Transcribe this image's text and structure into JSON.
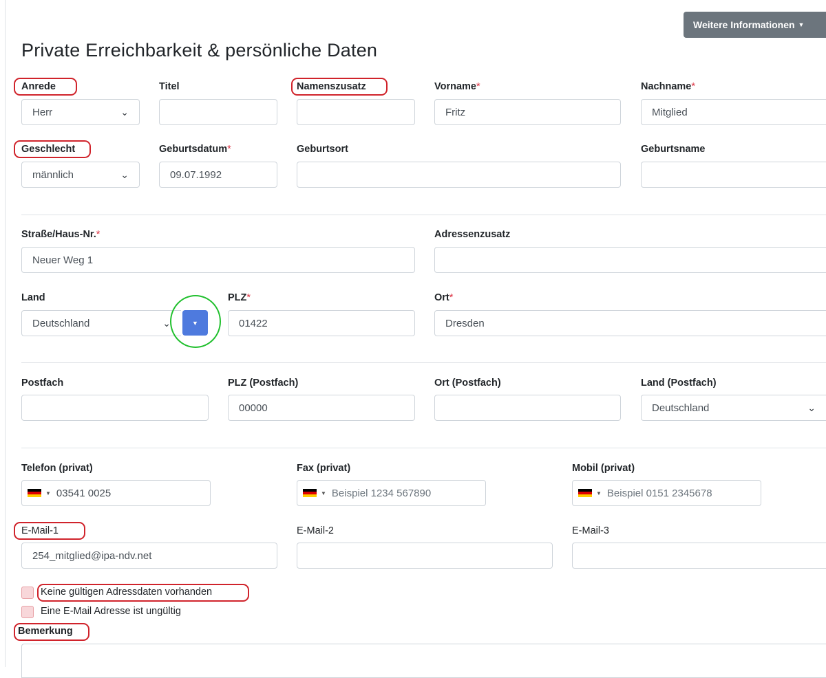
{
  "header": {
    "info_button_label": "Weitere Informationen",
    "title": "Private Erreichbarkeit & persönliche Daten"
  },
  "personal": {
    "anrede": {
      "label": "Anrede",
      "value": "Herr"
    },
    "titel": {
      "label": "Titel",
      "value": ""
    },
    "namenszusatz": {
      "label": "Namenszusatz",
      "value": ""
    },
    "vorname": {
      "label": "Vorname",
      "value": "Fritz"
    },
    "nachname": {
      "label": "Nachname",
      "value": "Mitglied"
    },
    "geschlecht": {
      "label": "Geschlecht",
      "value": "männlich"
    },
    "geburtsdatum": {
      "label": "Geburtsdatum",
      "value": "09.07.1992"
    },
    "geburtsort": {
      "label": "Geburtsort",
      "value": ""
    },
    "geburtsname": {
      "label": "Geburtsname",
      "value": ""
    },
    "required_mark": "*"
  },
  "address": {
    "strasse": {
      "label": "Straße/Haus-Nr.",
      "value": "Neuer Weg 1"
    },
    "adresszusatz": {
      "label": "Adressenzusatz",
      "value": ""
    },
    "land": {
      "label": "Land",
      "value": "Deutschland"
    },
    "plz": {
      "label": "PLZ",
      "value": "01422"
    },
    "ort": {
      "label": "Ort",
      "value": "Dresden"
    }
  },
  "postfach": {
    "postfach": {
      "label": "Postfach",
      "value": ""
    },
    "plz": {
      "label": "PLZ (Postfach)",
      "value": "00000"
    },
    "ort": {
      "label": "Ort (Postfach)",
      "value": ""
    },
    "land": {
      "label": "Land (Postfach)",
      "value": "Deutschland"
    }
  },
  "contact": {
    "telefon": {
      "label": "Telefon (privat)",
      "value": "03541 0025"
    },
    "fax": {
      "label": "Fax (privat)",
      "placeholder": "Beispiel 1234 567890"
    },
    "mobil": {
      "label": "Mobil (privat)",
      "placeholder": "Beispiel 0151 2345678"
    },
    "email1": {
      "label": "E-Mail-1",
      "value": "254_mitglied@ipa-ndv.net"
    },
    "email2": {
      "label": "E-Mail-2",
      "value": ""
    },
    "email3": {
      "label": "E-Mail-3",
      "value": ""
    }
  },
  "flags": {
    "keine_adresse": "Keine gültigen Adressdaten vorhanden",
    "email_ungueltig": "Eine E-Mail Adresse ist ungültig"
  },
  "bemerkung": {
    "label": "Bemerkung",
    "value": ""
  },
  "icons": {
    "chevron": "chevron-down-icon",
    "flag": "germany-flag-icon",
    "caret": "caret-down-icon"
  },
  "colors": {
    "annotation_red": "#d0232b",
    "annotation_green": "#22c02f",
    "blue_button": "#4e7ade",
    "required": "#dc3545"
  }
}
